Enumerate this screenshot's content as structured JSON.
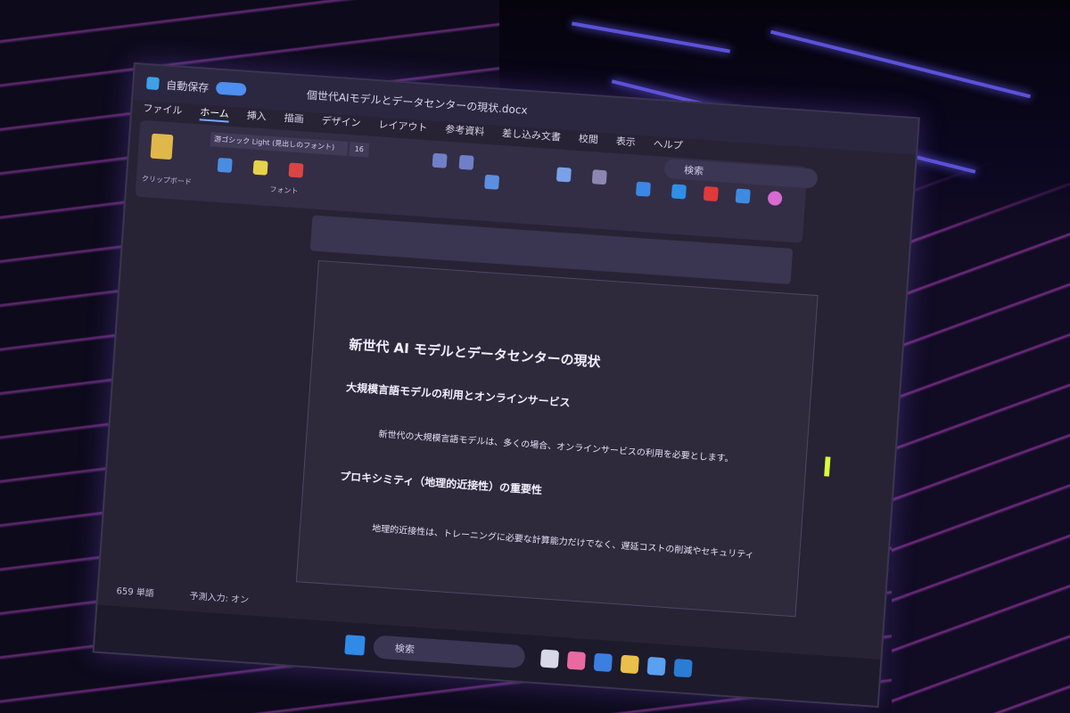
{
  "app": {
    "title": "自動保存",
    "file_name": "個世代AIモデルとデータセンターの現状.docx"
  },
  "tabs": [
    "ファイル",
    "ホーム",
    "挿入",
    "描画",
    "デザイン",
    "レイアウト",
    "参考資料",
    "差し込み文書",
    "校閲",
    "表示",
    "ヘルプ"
  ],
  "search": {
    "label": "検索"
  },
  "ribbon": {
    "font_name": "游ゴシック Light (見出しのフォント)",
    "font_size": "16",
    "group_font": "フォント",
    "group_clipboard": "クリップボード"
  },
  "document": {
    "heading1": "新世代 AI モデルとデータセンターの現状",
    "section1": "大規模言語モデルの利用とオンラインサービス",
    "bullet1": "新世代の大規模言語モデルは、多くの場合、オンラインサービスの利用を必要とします。",
    "section2": "プロキシミティ（地理的近接性）の重要性",
    "bullet2": "地理的近接性は、トレーニングに必要な計算能力だけでなく、遅延コストの削減やセキュリティ"
  },
  "status": {
    "words": "659 単語",
    "prediction": "予測入力: オン"
  },
  "taskbar": {
    "search": "検索"
  },
  "colors": {
    "accent": "#4d8ef0",
    "cursor": "#d9ff3a",
    "wall_stripe": "#6a2a78"
  }
}
